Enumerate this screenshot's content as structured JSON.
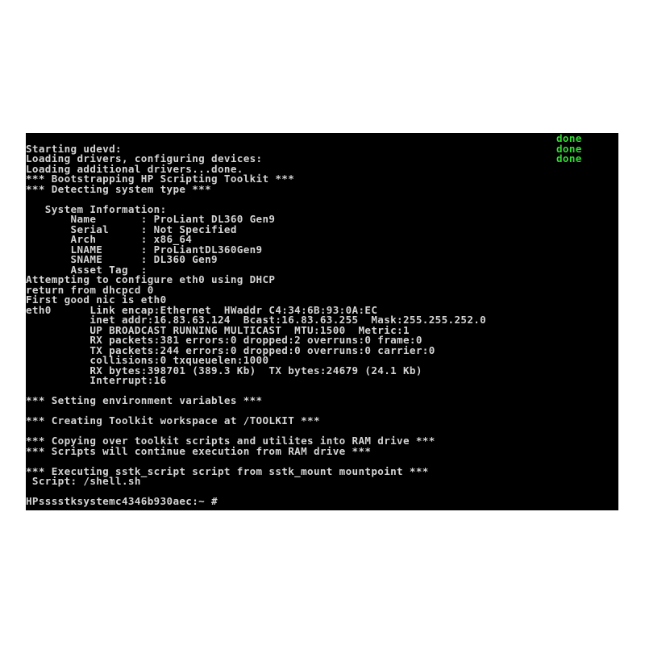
{
  "terminal": {
    "status_done": [
      "done",
      "done",
      "done"
    ],
    "lines": [
      "Starting udevd:",
      "Loading drivers, configuring devices:",
      "Loading additional drivers...done.",
      "*** Bootstrapping HP Scripting Toolkit ***",
      "*** Detecting system type ***",
      "",
      "   System Information:",
      "       Name       : ProLiant DL360 Gen9",
      "       Serial     : Not Specified",
      "       Arch       : x86_64",
      "       LNAME      : ProLiantDL360Gen9",
      "       SNAME      : DL360 Gen9",
      "       Asset Tag  :",
      "Attempting to configure eth0 using DHCP",
      "return from dhcpcd 0",
      "First good nic is eth0",
      "eth0      Link encap:Ethernet  HWaddr C4:34:6B:93:0A:EC",
      "          inet addr:16.83.63.124  Bcast:16.83.63.255  Mask:255.255.252.0",
      "          UP BROADCAST RUNNING MULTICAST  MTU:1500  Metric:1",
      "          RX packets:381 errors:0 dropped:2 overruns:0 frame:0",
      "          TX packets:244 errors:0 dropped:0 overruns:0 carrier:0",
      "          collisions:0 txqueuelen:1000",
      "          RX bytes:398701 (389.3 Kb)  TX bytes:24679 (24.1 Kb)",
      "          Interrupt:16",
      "",
      "*** Setting environment variables ***",
      "",
      "*** Creating Toolkit workspace at /TOOLKIT ***",
      "",
      "*** Copying over toolkit scripts and utilites into RAM drive ***",
      "*** Scripts will continue execution from RAM drive ***",
      "",
      "*** Executing sstk_script script from sstk_mount mountpoint ***",
      " Script: /shell.sh",
      "",
      "HPsssstksystemc4346b930aec:~ #"
    ],
    "prompt": "HPsssstksystemc4346b930aec:~ #",
    "colors": {
      "background": "#000000",
      "text": "#d4d4d4",
      "done": "#33dd33"
    }
  }
}
